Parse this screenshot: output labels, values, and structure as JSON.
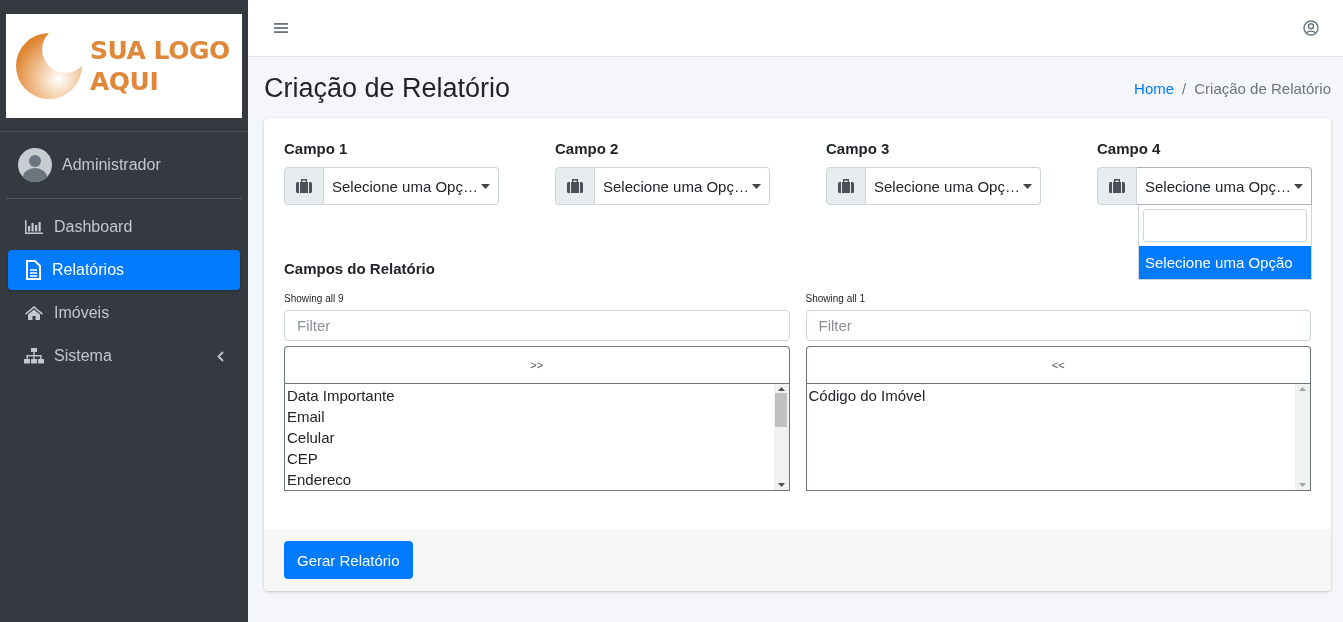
{
  "logo": {
    "lines": [
      "SUA LOGO",
      "AQUI"
    ]
  },
  "user": {
    "name": "Administrador"
  },
  "sidebar": {
    "items": [
      {
        "label": "Dashboard",
        "selected": false,
        "has_caret": false
      },
      {
        "label": "Relatórios",
        "selected": true,
        "has_caret": false
      },
      {
        "label": "Imóveis",
        "selected": false,
        "has_caret": false
      },
      {
        "label": "Sistema",
        "selected": false,
        "has_caret": true
      }
    ]
  },
  "page": {
    "title": "Criação de Relatório",
    "breadcrumb_separator": "/",
    "breadcrumb": [
      {
        "label": "Home",
        "link": true
      },
      {
        "label": "Criação de Relatório",
        "link": false
      }
    ]
  },
  "fields": [
    {
      "label": "Campo 1",
      "value": "Selecione uma Opç…",
      "expanded": false
    },
    {
      "label": "Campo 2",
      "value": "Selecione uma Opç…",
      "expanded": false
    },
    {
      "label": "Campo 3",
      "value": "Selecione uma Opç…",
      "expanded": false
    },
    {
      "label": "Campo 4",
      "value": "Selecione uma Opç…",
      "expanded": true,
      "options": [
        {
          "label": "Selecione uma Opção",
          "selected": true
        }
      ]
    }
  ],
  "report_fields": {
    "title": "Campos do Relatório",
    "lists": [
      {
        "info": "Showing all 9",
        "filter_placeholder": "Filter",
        "move_button": ">>",
        "items": [
          "Data Importante",
          "Email",
          "Celular",
          "CEP",
          "Endereco"
        ],
        "scrollable": true
      },
      {
        "info": "Showing all 1",
        "filter_placeholder": "Filter",
        "move_button": "<<",
        "items": [
          "Código do Imóvel"
        ],
        "scrollable": false
      }
    ]
  },
  "submit_button": "Gerar Relatório"
}
